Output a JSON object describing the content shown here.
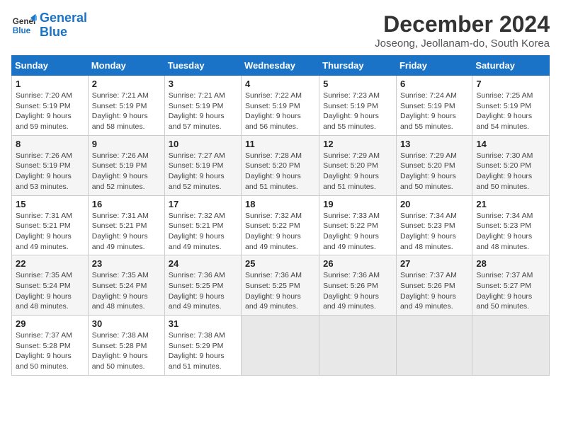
{
  "logo": {
    "line1": "General",
    "line2": "Blue"
  },
  "title": "December 2024",
  "location": "Joseong, Jeollanam-do, South Korea",
  "weekdays": [
    "Sunday",
    "Monday",
    "Tuesday",
    "Wednesday",
    "Thursday",
    "Friday",
    "Saturday"
  ],
  "weeks": [
    [
      {
        "day": "1",
        "sunrise": "Sunrise: 7:20 AM",
        "sunset": "Sunset: 5:19 PM",
        "daylight": "Daylight: 9 hours and 59 minutes."
      },
      {
        "day": "2",
        "sunrise": "Sunrise: 7:21 AM",
        "sunset": "Sunset: 5:19 PM",
        "daylight": "Daylight: 9 hours and 58 minutes."
      },
      {
        "day": "3",
        "sunrise": "Sunrise: 7:21 AM",
        "sunset": "Sunset: 5:19 PM",
        "daylight": "Daylight: 9 hours and 57 minutes."
      },
      {
        "day": "4",
        "sunrise": "Sunrise: 7:22 AM",
        "sunset": "Sunset: 5:19 PM",
        "daylight": "Daylight: 9 hours and 56 minutes."
      },
      {
        "day": "5",
        "sunrise": "Sunrise: 7:23 AM",
        "sunset": "Sunset: 5:19 PM",
        "daylight": "Daylight: 9 hours and 55 minutes."
      },
      {
        "day": "6",
        "sunrise": "Sunrise: 7:24 AM",
        "sunset": "Sunset: 5:19 PM",
        "daylight": "Daylight: 9 hours and 55 minutes."
      },
      {
        "day": "7",
        "sunrise": "Sunrise: 7:25 AM",
        "sunset": "Sunset: 5:19 PM",
        "daylight": "Daylight: 9 hours and 54 minutes."
      }
    ],
    [
      {
        "day": "8",
        "sunrise": "Sunrise: 7:26 AM",
        "sunset": "Sunset: 5:19 PM",
        "daylight": "Daylight: 9 hours and 53 minutes."
      },
      {
        "day": "9",
        "sunrise": "Sunrise: 7:26 AM",
        "sunset": "Sunset: 5:19 PM",
        "daylight": "Daylight: 9 hours and 52 minutes."
      },
      {
        "day": "10",
        "sunrise": "Sunrise: 7:27 AM",
        "sunset": "Sunset: 5:19 PM",
        "daylight": "Daylight: 9 hours and 52 minutes."
      },
      {
        "day": "11",
        "sunrise": "Sunrise: 7:28 AM",
        "sunset": "Sunset: 5:20 PM",
        "daylight": "Daylight: 9 hours and 51 minutes."
      },
      {
        "day": "12",
        "sunrise": "Sunrise: 7:29 AM",
        "sunset": "Sunset: 5:20 PM",
        "daylight": "Daylight: 9 hours and 51 minutes."
      },
      {
        "day": "13",
        "sunrise": "Sunrise: 7:29 AM",
        "sunset": "Sunset: 5:20 PM",
        "daylight": "Daylight: 9 hours and 50 minutes."
      },
      {
        "day": "14",
        "sunrise": "Sunrise: 7:30 AM",
        "sunset": "Sunset: 5:20 PM",
        "daylight": "Daylight: 9 hours and 50 minutes."
      }
    ],
    [
      {
        "day": "15",
        "sunrise": "Sunrise: 7:31 AM",
        "sunset": "Sunset: 5:21 PM",
        "daylight": "Daylight: 9 hours and 49 minutes."
      },
      {
        "day": "16",
        "sunrise": "Sunrise: 7:31 AM",
        "sunset": "Sunset: 5:21 PM",
        "daylight": "Daylight: 9 hours and 49 minutes."
      },
      {
        "day": "17",
        "sunrise": "Sunrise: 7:32 AM",
        "sunset": "Sunset: 5:21 PM",
        "daylight": "Daylight: 9 hours and 49 minutes."
      },
      {
        "day": "18",
        "sunrise": "Sunrise: 7:32 AM",
        "sunset": "Sunset: 5:22 PM",
        "daylight": "Daylight: 9 hours and 49 minutes."
      },
      {
        "day": "19",
        "sunrise": "Sunrise: 7:33 AM",
        "sunset": "Sunset: 5:22 PM",
        "daylight": "Daylight: 9 hours and 49 minutes."
      },
      {
        "day": "20",
        "sunrise": "Sunrise: 7:34 AM",
        "sunset": "Sunset: 5:23 PM",
        "daylight": "Daylight: 9 hours and 48 minutes."
      },
      {
        "day": "21",
        "sunrise": "Sunrise: 7:34 AM",
        "sunset": "Sunset: 5:23 PM",
        "daylight": "Daylight: 9 hours and 48 minutes."
      }
    ],
    [
      {
        "day": "22",
        "sunrise": "Sunrise: 7:35 AM",
        "sunset": "Sunset: 5:24 PM",
        "daylight": "Daylight: 9 hours and 48 minutes."
      },
      {
        "day": "23",
        "sunrise": "Sunrise: 7:35 AM",
        "sunset": "Sunset: 5:24 PM",
        "daylight": "Daylight: 9 hours and 48 minutes."
      },
      {
        "day": "24",
        "sunrise": "Sunrise: 7:36 AM",
        "sunset": "Sunset: 5:25 PM",
        "daylight": "Daylight: 9 hours and 49 minutes."
      },
      {
        "day": "25",
        "sunrise": "Sunrise: 7:36 AM",
        "sunset": "Sunset: 5:25 PM",
        "daylight": "Daylight: 9 hours and 49 minutes."
      },
      {
        "day": "26",
        "sunrise": "Sunrise: 7:36 AM",
        "sunset": "Sunset: 5:26 PM",
        "daylight": "Daylight: 9 hours and 49 minutes."
      },
      {
        "day": "27",
        "sunrise": "Sunrise: 7:37 AM",
        "sunset": "Sunset: 5:26 PM",
        "daylight": "Daylight: 9 hours and 49 minutes."
      },
      {
        "day": "28",
        "sunrise": "Sunrise: 7:37 AM",
        "sunset": "Sunset: 5:27 PM",
        "daylight": "Daylight: 9 hours and 50 minutes."
      }
    ],
    [
      {
        "day": "29",
        "sunrise": "Sunrise: 7:37 AM",
        "sunset": "Sunset: 5:28 PM",
        "daylight": "Daylight: 9 hours and 50 minutes."
      },
      {
        "day": "30",
        "sunrise": "Sunrise: 7:38 AM",
        "sunset": "Sunset: 5:28 PM",
        "daylight": "Daylight: 9 hours and 50 minutes."
      },
      {
        "day": "31",
        "sunrise": "Sunrise: 7:38 AM",
        "sunset": "Sunset: 5:29 PM",
        "daylight": "Daylight: 9 hours and 51 minutes."
      },
      null,
      null,
      null,
      null
    ]
  ]
}
